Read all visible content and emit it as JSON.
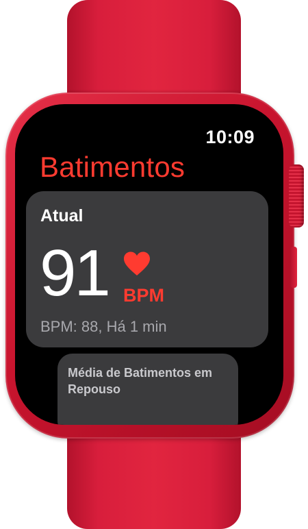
{
  "status_bar": {
    "time": "10:09"
  },
  "app": {
    "title": "Batimentos"
  },
  "current_card": {
    "label": "Atual",
    "value": "91",
    "unit": "BPM",
    "detail": "BPM: 88, Há 1 min",
    "icon": "heart-icon"
  },
  "resting_card": {
    "label": "Média de Batimentos em Repouso"
  },
  "colors": {
    "accent": "#ff3b30",
    "band": "#e1253f",
    "screen": "#000000",
    "card": "#3b3b3d"
  }
}
